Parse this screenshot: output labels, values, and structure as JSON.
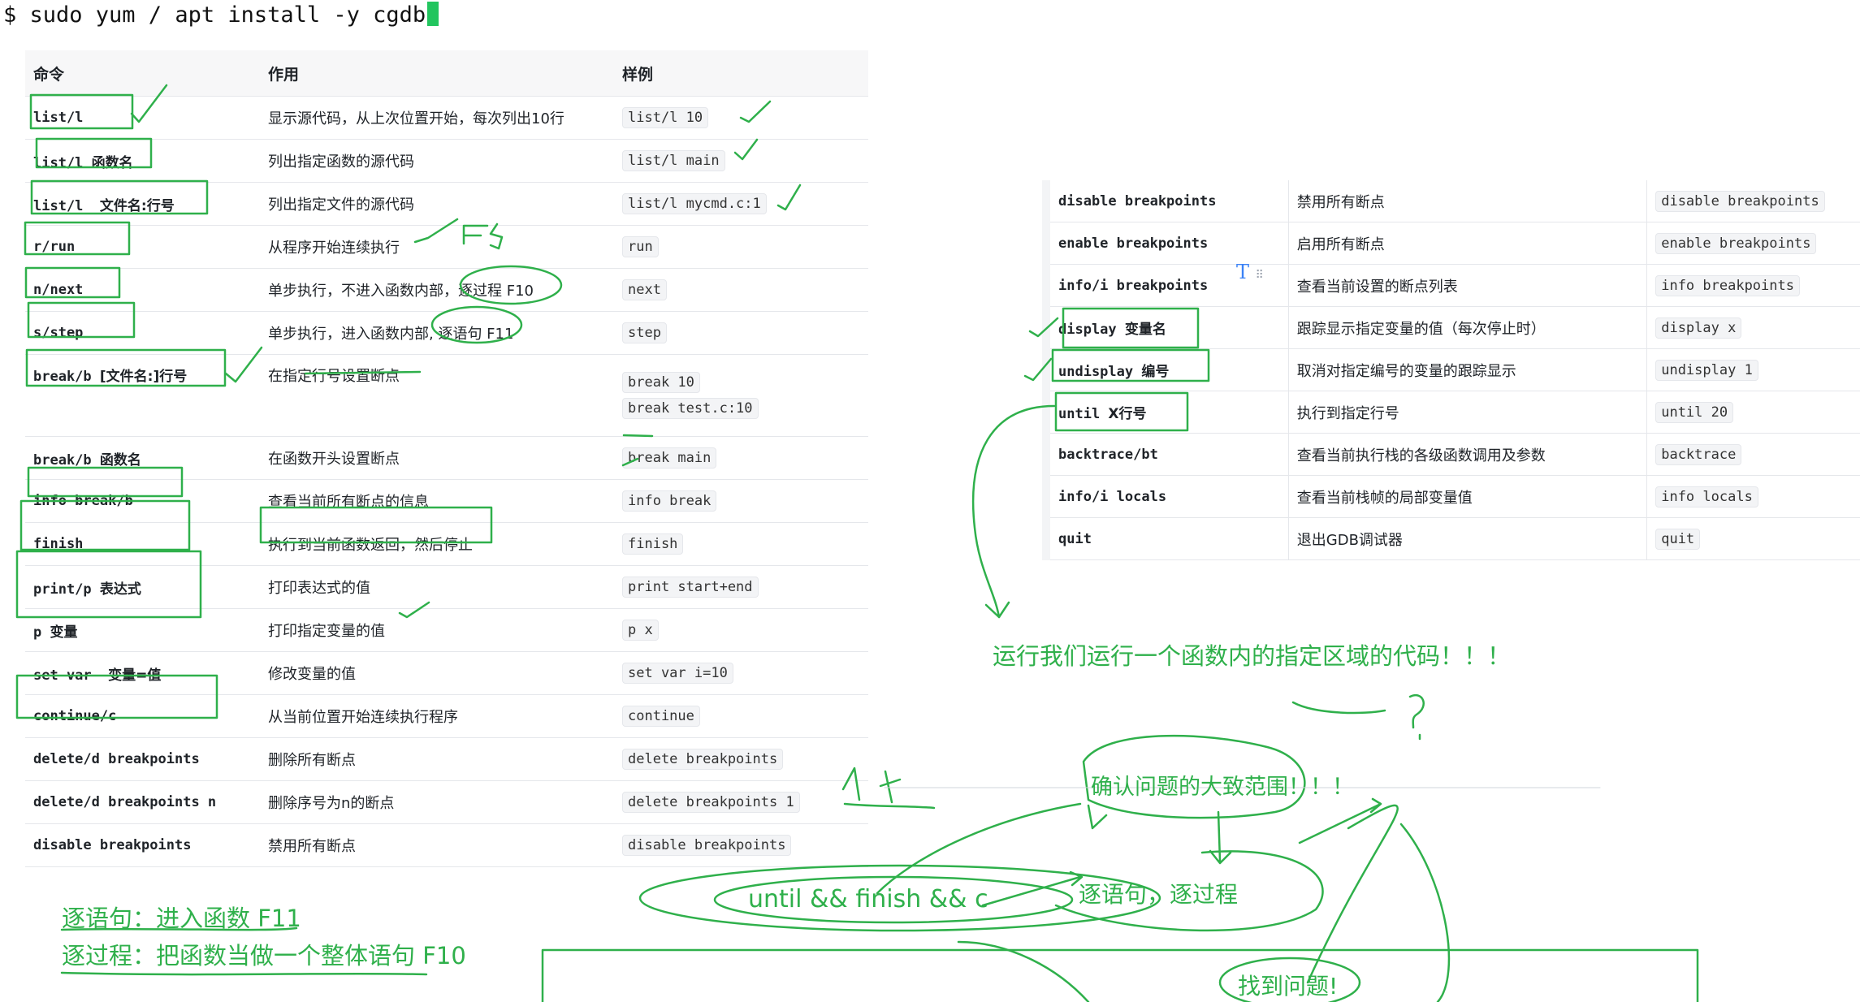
{
  "terminal": {
    "command": "$ sudo yum / apt install -y cgdb"
  },
  "left_table": {
    "headers": [
      "命令",
      "作用",
      "样例"
    ],
    "rows": [
      {
        "cmd": "list/l",
        "cmd_cn": "",
        "desc": "显示源代码，从上次位置开始，每次列出10行",
        "ex": [
          "list/l 10"
        ]
      },
      {
        "cmd": "list/l ",
        "cmd_cn": "函数名",
        "desc": "列出指定函数的源代码",
        "ex": [
          "list/l main"
        ]
      },
      {
        "cmd": "list/l  ",
        "cmd_cn": "文件名:行号",
        "desc": "列出指定文件的源代码",
        "ex": [
          "list/l mycmd.c:1"
        ]
      },
      {
        "cmd": "r/run",
        "cmd_cn": "",
        "desc": "从程序开始连续执行",
        "ex": [
          "run"
        ]
      },
      {
        "cmd": "n/next",
        "cmd_cn": "",
        "desc": "单步执行，不进入函数内部，逐过程 F10",
        "ex": [
          "next"
        ]
      },
      {
        "cmd": "s/step",
        "cmd_cn": "",
        "desc": "单步执行，进入函数内部, 逐语句 F11",
        "ex": [
          "step"
        ]
      },
      {
        "cmd": "break/b ",
        "cmd_cn": "[文件名:]行号",
        "desc": "在指定行号设置断点",
        "ex": [
          "break 10",
          "break test.c:10"
        ]
      },
      {
        "cmd": "break/b ",
        "cmd_cn": "函数名",
        "desc": "在函数开头设置断点",
        "ex": [
          "break main"
        ]
      },
      {
        "cmd": "info break/b",
        "cmd_cn": "",
        "desc": "查看当前所有断点的信息",
        "ex": [
          "info break"
        ]
      },
      {
        "cmd": "finish",
        "cmd_cn": "",
        "desc": "执行到当前函数返回，然后停止",
        "ex": [
          "finish"
        ]
      },
      {
        "cmd": "print/p ",
        "cmd_cn": "表达式",
        "desc": "打印表达式的值",
        "ex": [
          "print start+end"
        ]
      },
      {
        "cmd": "p ",
        "cmd_cn": "变量",
        "desc": "打印指定变量的值",
        "ex": [
          "p x"
        ]
      },
      {
        "cmd": "set var  ",
        "cmd_cn": "变量=值",
        "desc": "修改变量的值",
        "ex": [
          "set var i=10"
        ]
      },
      {
        "cmd": "continue/c",
        "cmd_cn": "",
        "desc": "从当前位置开始连续执行程序",
        "ex": [
          "continue"
        ]
      },
      {
        "cmd": "delete/d breakpoints",
        "cmd_cn": "",
        "desc": "删除所有断点",
        "ex": [
          "delete breakpoints"
        ]
      },
      {
        "cmd": "delete/d breakpoints n",
        "cmd_cn": "",
        "desc": "删除序号为n的断点",
        "ex": [
          "delete breakpoints 1"
        ]
      },
      {
        "cmd": "disable breakpoints",
        "cmd_cn": "",
        "desc": "禁用所有断点",
        "ex": [
          "disable breakpoints"
        ]
      }
    ]
  },
  "right_table": {
    "rows": [
      {
        "cmd": "disable breakpoints",
        "cmd_cn": "",
        "desc": "禁用所有断点",
        "ex": [
          "disable breakpoints"
        ]
      },
      {
        "cmd": "enable breakpoints",
        "cmd_cn": "",
        "desc": "启用所有断点",
        "ex": [
          "enable breakpoints"
        ]
      },
      {
        "cmd": "info/i breakpoints",
        "cmd_cn": "",
        "desc": "查看当前设置的断点列表",
        "ex": [
          "info breakpoints"
        ]
      },
      {
        "cmd": "display ",
        "cmd_cn": "变量名",
        "desc": "跟踪显示指定变量的值（每次停止时）",
        "ex": [
          "display x"
        ]
      },
      {
        "cmd": "undisplay ",
        "cmd_cn": "编号",
        "desc": "取消对指定编号的变量的跟踪显示",
        "ex": [
          "undisplay 1"
        ]
      },
      {
        "cmd": "until ",
        "cmd_cn": "X行号",
        "desc": "执行到指定行号",
        "ex": [
          "until 20"
        ]
      },
      {
        "cmd": "backtrace/bt",
        "cmd_cn": "",
        "desc": "查看当前执行栈的各级函数调用及参数",
        "ex": [
          "backtrace"
        ]
      },
      {
        "cmd": "info/i locals",
        "cmd_cn": "",
        "desc": "查看当前栈帧的局部变量值",
        "ex": [
          "info locals"
        ]
      },
      {
        "cmd": "quit",
        "cmd_cn": "",
        "desc": "退出GDB调试器",
        "ex": [
          "quit"
        ]
      }
    ]
  },
  "toolbar_icon": {
    "glyph": "T",
    "handle": "⠿",
    "icon": "text-format-icon"
  },
  "notes": {
    "run_region": "运行我们运行一个函数内的指定区域的代码！！！",
    "confirm_range": "确认问题的大致范围！！！",
    "chain": "until && finish && c",
    "step_over": "逐语句，逐过程",
    "found": "找到问题!",
    "step_into_def": "逐语句：进入函数   F11",
    "step_over_def": "逐过程：把函数当做一个整体语句 F10"
  },
  "colors": {
    "annotation_green": "#2fb04b",
    "cursor_green": "#22c55e",
    "accent_blue": "#3b82f6"
  }
}
